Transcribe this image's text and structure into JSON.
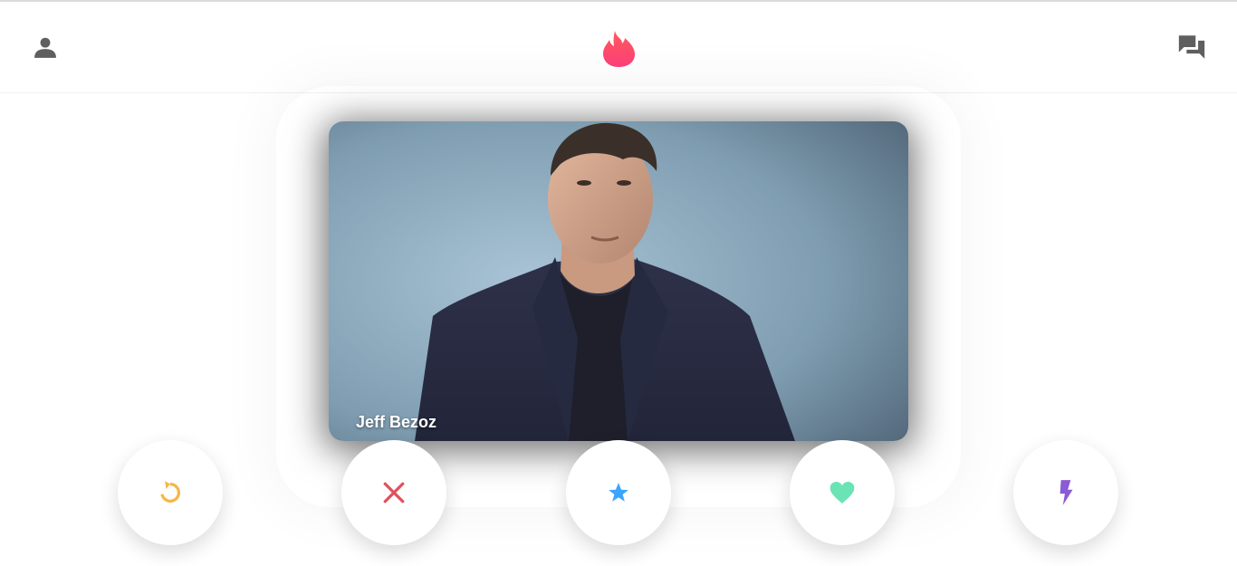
{
  "header": {
    "profile_icon": "person-icon",
    "logo_icon": "flame-logo-icon",
    "chat_icon": "chat-bubbles-icon"
  },
  "card": {
    "name": "Jeff Bezoz",
    "photo": "man-in-dark-suit-portrait"
  },
  "actions": [
    {
      "icon": "rewind-icon",
      "color": "#f5b748"
    },
    {
      "icon": "close-icon",
      "color": "#e0505e"
    },
    {
      "icon": "star-icon",
      "color": "#3ca4ff"
    },
    {
      "icon": "heart-icon",
      "color": "#6be4b5"
    },
    {
      "icon": "lightning-icon",
      "color": "#8b5ad6"
    }
  ],
  "colors": {
    "logo_gradient_start": "#ff4458",
    "logo_gradient_end": "#fd5068"
  }
}
